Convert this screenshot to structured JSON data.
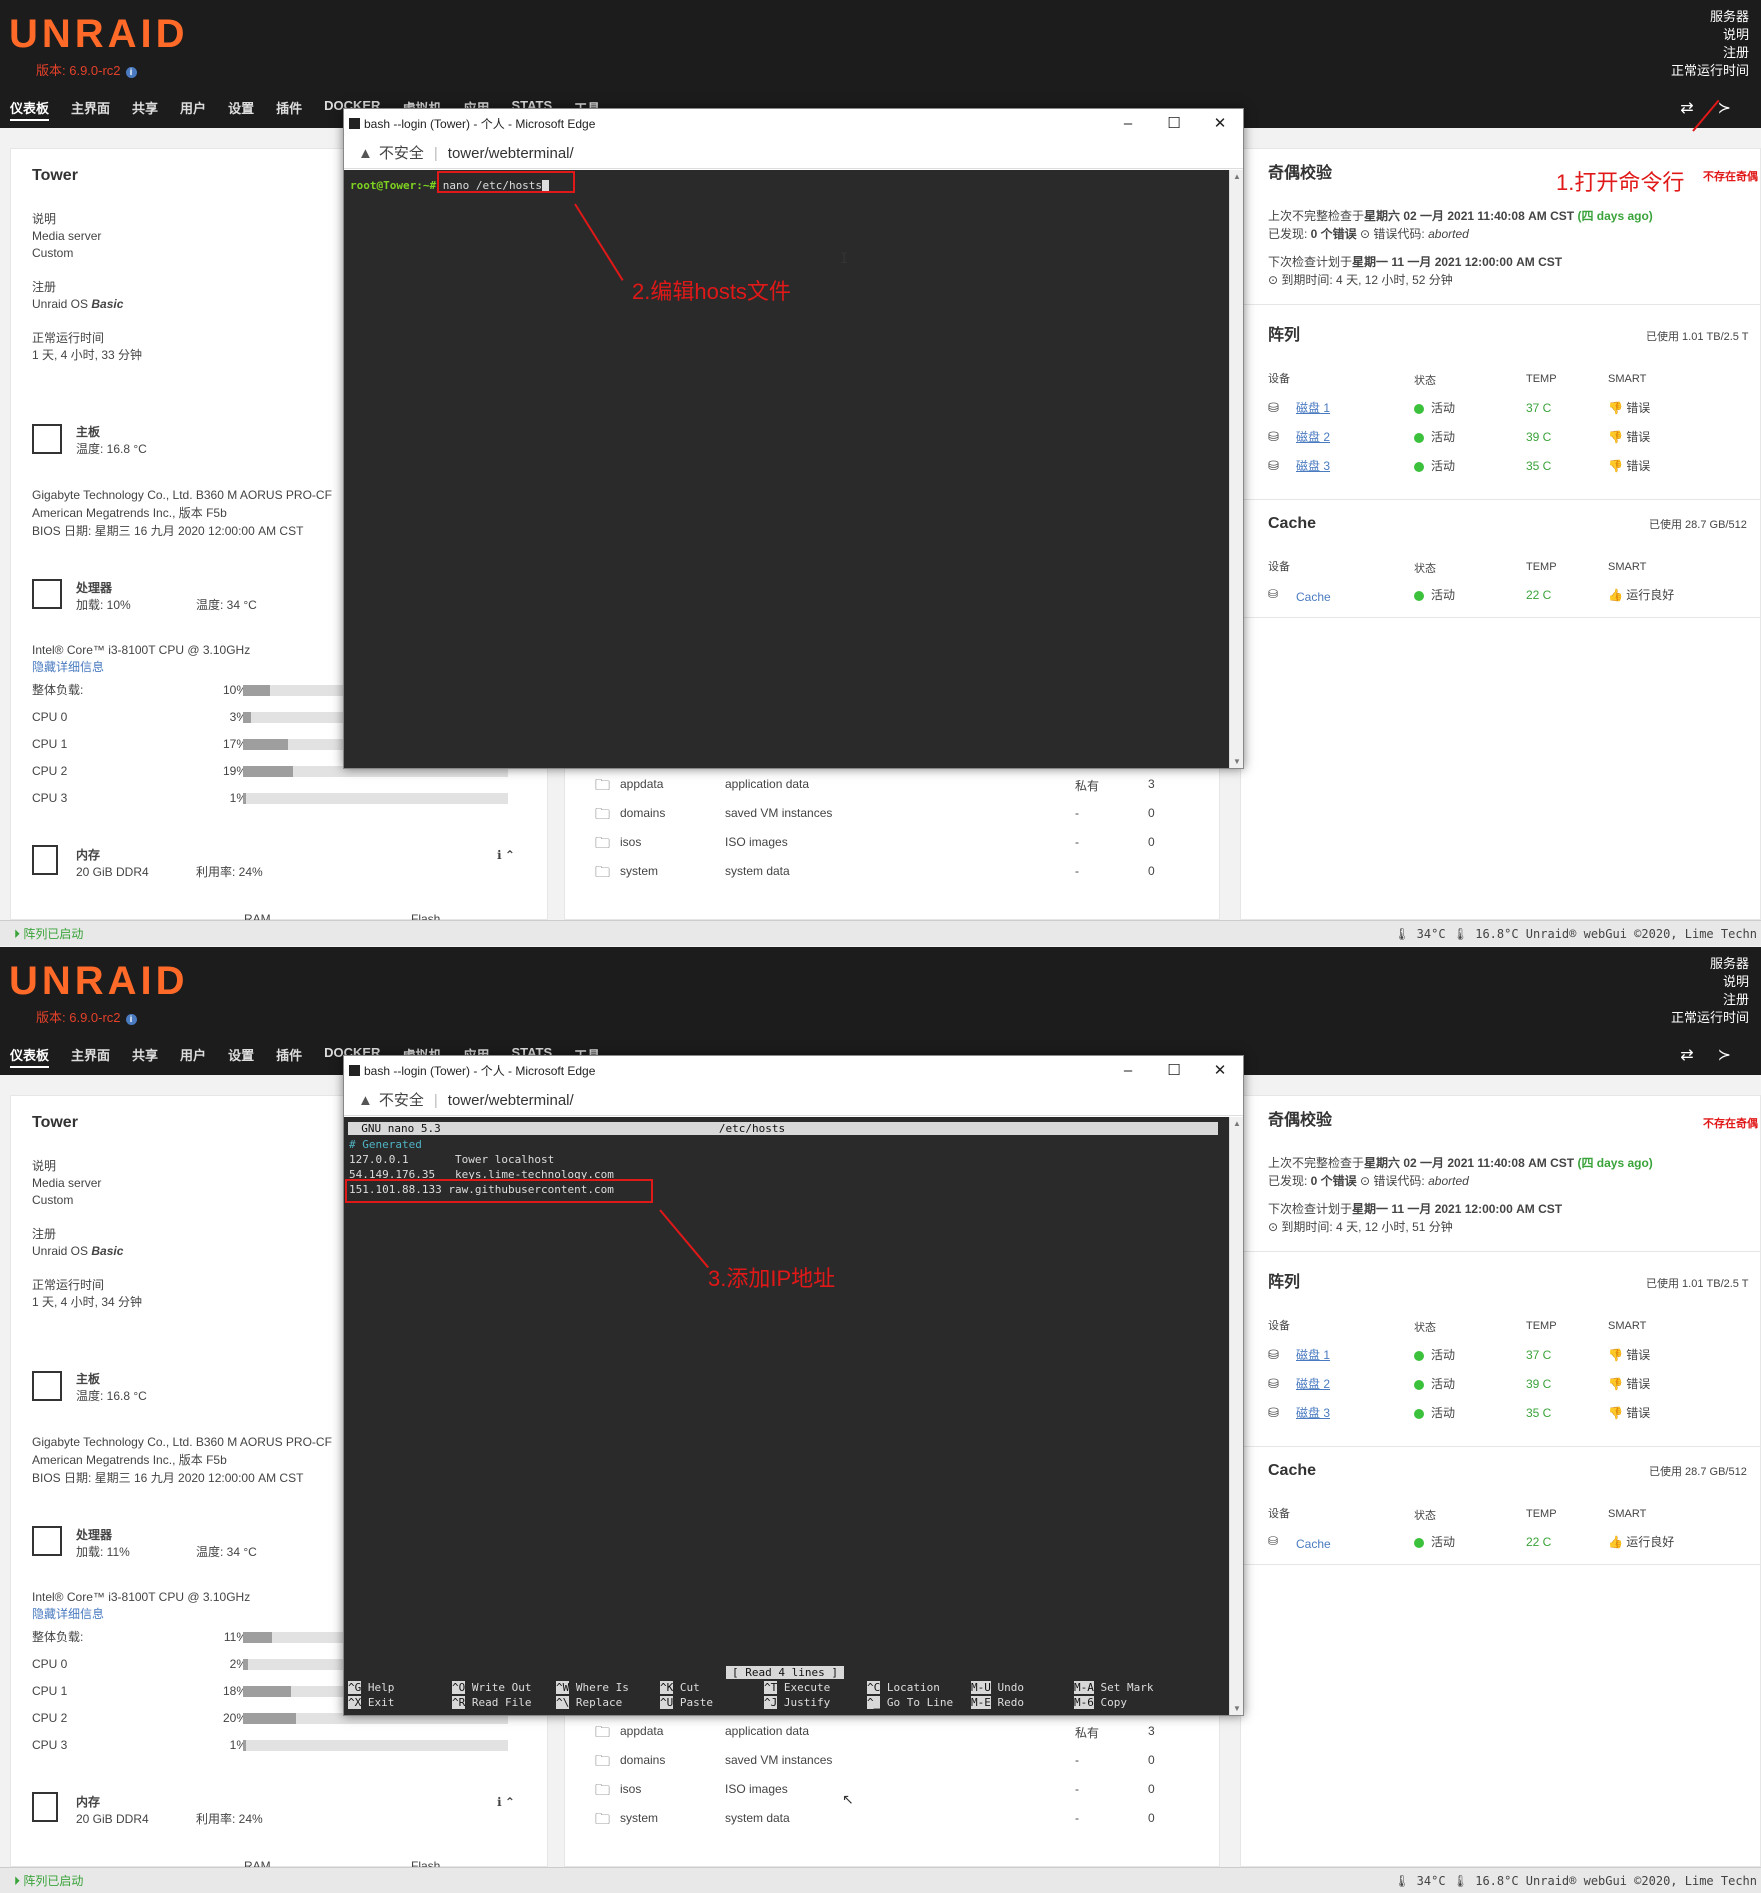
{
  "header": {
    "logo": "UNRAID",
    "version": "版本: 6.9.0-rc2",
    "server_lines": [
      "服务器",
      "说明",
      "注册",
      "正常运行时间"
    ],
    "nav": [
      "仪表板",
      "主界面",
      "共享",
      "用户",
      "设置",
      "插件",
      "DOCKER",
      "虚拟机",
      "应用",
      "STATS",
      "工具"
    ]
  },
  "browser": {
    "title": "bash --login (Tower) - 个人 - Microsoft Edge",
    "insecure": "不安全",
    "url": "tower/webterminal/"
  },
  "left": {
    "server_name": "Tower",
    "desc_label": "说明",
    "desc1": "Media server",
    "desc2": "Custom",
    "reg_label": "注册",
    "reg_value": "Unraid OS ",
    "reg_value_b": "Basic",
    "uptime_label": "正常运行时间",
    "mb_label": "主板",
    "mb_temp": "温度: 16.8 °C",
    "mb_line1": "Gigabyte Technology Co., Ltd. B360 M AORUS PRO-CF",
    "mb_line2": "American Megatrends Inc., 版本 F5b",
    "mb_line3": "BIOS 日期: 星期三 16 九月 2020 12:00:00 AM CST",
    "cpu_label": "处理器",
    "cpu_temp": "温度: 34 °C",
    "cpu_model": "Intel® Core™ i3-8100T CPU @ 3.10GHz",
    "hide_details": "隐藏详细信息",
    "load_label": "整体负载:",
    "cpu_names": [
      "CPU 0",
      "CPU 1",
      "CPU 2",
      "CPU 3"
    ],
    "mem_label": "内存",
    "mem_type": "20 GiB DDR4",
    "mem_usage": "利用率: 24%",
    "ram": "RAM",
    "flash": "Flash"
  },
  "shares": [
    {
      "name": "appdata",
      "desc": "application data",
      "sec": "私有",
      "n": "3"
    },
    {
      "name": "domains",
      "desc": "saved VM instances",
      "sec": "-",
      "n": "0"
    },
    {
      "name": "isos",
      "desc": "ISO images",
      "sec": "-",
      "n": "0"
    },
    {
      "name": "system",
      "desc": "system data",
      "sec": "-",
      "n": "0"
    }
  ],
  "right": {
    "parity_title": "奇偶校验",
    "parity_missing": "不存在奇偶",
    "last_check_pre": "上次不完整检查于",
    "last_check_date": "星期六 02 一月 2021 11:40:08 AM CST",
    "days_ago": "(四 days ago)",
    "found": "已发现: ",
    "found_b": "0 个错误",
    "err_code": " 错误代码: ",
    "aborted": "aborted",
    "next_check_pre": "下次检查计划于",
    "next_check_date": "星期一 11 一月 2021 12:00:00 AM CST",
    "array_title": "阵列",
    "array_used": "已使用 1.01 TB/2.5 T",
    "col_dev": "设备",
    "col_state": "状态",
    "col_temp": "TEMP",
    "col_smart": "SMART",
    "disks": [
      {
        "name": "磁盘 1",
        "state": "活动",
        "temp": "37 C",
        "smart": "错误"
      },
      {
        "name": "磁盘 2",
        "state": "活动",
        "temp": "39 C",
        "smart": "错误"
      },
      {
        "name": "磁盘 3",
        "state": "活动",
        "temp": "35 C",
        "smart": "错误"
      }
    ],
    "cache_title": "Cache",
    "cache_used": "已使用 28.7 GB/512",
    "cache_name": "Cache",
    "cache_state": "活动",
    "cache_temp": "22 C",
    "cache_smart": "运行良好"
  },
  "footer": {
    "left": "阵列已启动",
    "right": "🌡 34°C  🌡 16.8°C   Unraid® webGui ©2020, Lime Techn"
  },
  "s1": {
    "uptime": "1 天, 4 小时, 33 分钟",
    "cpu_load": "加载: 10%",
    "overall": "10%",
    "cpus": [
      3,
      17,
      19,
      1
    ],
    "expire": "到期时间: 4 天, 12 小时, 52 分钟",
    "prompt": "root@Tower:~#",
    "cmd": " nano /etc/hosts",
    "anno1": "1.打开命令行",
    "anno2": "2.编辑hosts文件"
  },
  "s2": {
    "uptime": "1 天, 4 小时, 34 分钟",
    "cpu_load": "加载: 11%",
    "overall": "11%",
    "cpus": [
      2,
      18,
      20,
      1
    ],
    "expire": "到期时间: 4 天, 12 小时, 51 分钟",
    "nano_title": "  GNU nano 5.3                                          /etc/hosts",
    "lines": [
      "# Generated",
      "127.0.0.1       Tower localhost",
      "54.149.176.35   keys.lime-technology.com",
      "151.101.88.133 raw.githubusercontent.com"
    ],
    "status": "[ Read 4 lines ]",
    "keys1": [
      [
        "^G",
        "Help"
      ],
      [
        "^O",
        "Write Out"
      ],
      [
        "^W",
        "Where Is"
      ],
      [
        "^K",
        "Cut"
      ],
      [
        "^T",
        "Execute"
      ],
      [
        "^C",
        "Location"
      ],
      [
        "M-U",
        "Undo"
      ],
      [
        "M-A",
        "Set Mark"
      ]
    ],
    "keys2": [
      [
        "^X",
        "Exit"
      ],
      [
        "^R",
        "Read File"
      ],
      [
        "^\\",
        "Replace"
      ],
      [
        "^U",
        "Paste"
      ],
      [
        "^J",
        "Justify"
      ],
      [
        "^_",
        "Go To Line"
      ],
      [
        "M-E",
        "Redo"
      ],
      [
        "M-6",
        "Copy"
      ]
    ],
    "anno3": "3.添加IP地址"
  }
}
